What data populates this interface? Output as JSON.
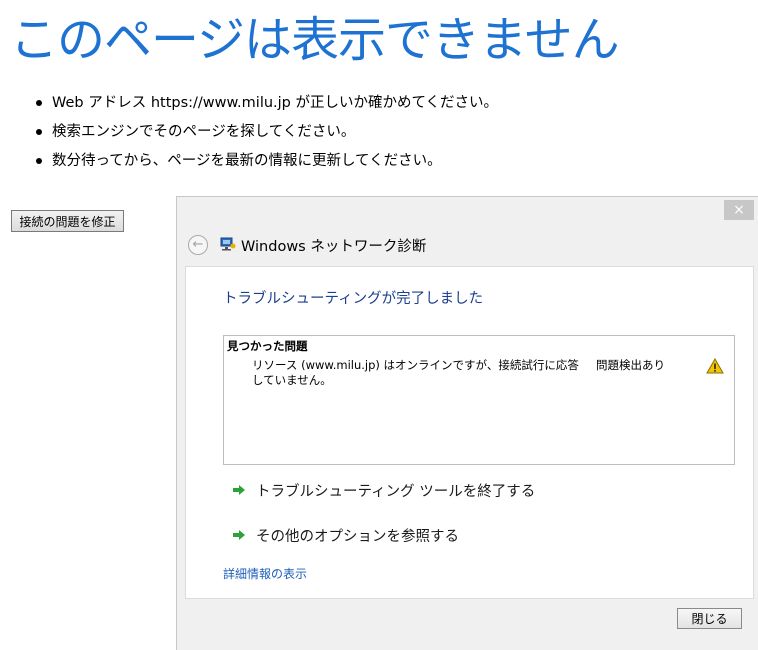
{
  "page": {
    "title": "このページは表示できません",
    "tips": [
      "Web アドレス https://www.milu.jp が正しいか確かめてください。",
      "検索エンジンでそのページを探してください。",
      "数分待ってから、ページを最新の情報に更新してください。"
    ],
    "fix_button_label": "接続の問題を修正"
  },
  "dialog": {
    "close_glyph": "×",
    "title": "Windows ネットワーク診断",
    "status_heading": "トラブルシューティングが完了しました",
    "problems": {
      "header": "見つかった問題",
      "items": [
        {
          "description": "リソース (www.milu.jp) はオンラインですが、接続試行に応答していません。",
          "status": "問題検出あり",
          "icon": "warning-icon"
        }
      ]
    },
    "options": [
      "トラブルシューティング ツールを終了する",
      "その他のオプションを参照する"
    ],
    "detail_link": "詳細情報の表示",
    "close_button_label": "閉じる"
  },
  "colors": {
    "title_blue": "#1e73d2",
    "heading_navy": "#1d3f8f",
    "link_blue": "#1d5fb9",
    "arrow_green": "#2aa43a",
    "warning_yellow": "#f5c400"
  }
}
